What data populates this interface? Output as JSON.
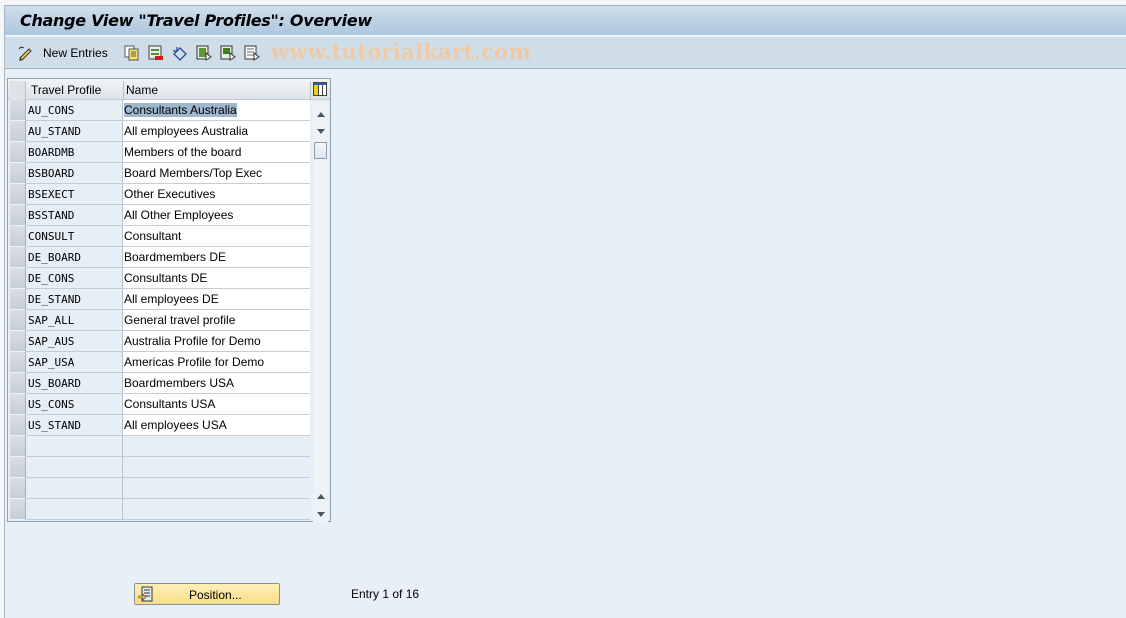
{
  "window": {
    "title": "Change View \"Travel Profiles\": Overview"
  },
  "toolbar": {
    "items": [
      {
        "icon": "edit-pencil-icon",
        "label": "New Entries"
      },
      {
        "icon": "copy-icon",
        "label": ""
      },
      {
        "icon": "delete-icon",
        "label": ""
      },
      {
        "icon": "undo-icon",
        "label": ""
      },
      {
        "icon": "select-all-icon",
        "label": ""
      },
      {
        "icon": "select-block-icon",
        "label": ""
      },
      {
        "icon": "deselect-all-icon",
        "label": ""
      }
    ],
    "watermark": "www.tutorialkart.com"
  },
  "table": {
    "columns": [
      "Travel Profile",
      "Name"
    ],
    "rows": [
      {
        "profile": "AU_CONS",
        "name": "Consultants Australia",
        "selected": true
      },
      {
        "profile": "AU_STAND",
        "name": "All employees Australia"
      },
      {
        "profile": "BOARDMB",
        "name": "Members of the board"
      },
      {
        "profile": "BSBOARD",
        "name": "Board Members/Top Exec"
      },
      {
        "profile": "BSEXECT",
        "name": "Other Executives"
      },
      {
        "profile": "BSSTAND",
        "name": "All Other Employees"
      },
      {
        "profile": "CONSULT",
        "name": "Consultant"
      },
      {
        "profile": "DE_BOARD",
        "name": "Boardmembers DE"
      },
      {
        "profile": "DE_CONS",
        "name": "Consultants DE"
      },
      {
        "profile": "DE_STAND",
        "name": "All employees DE"
      },
      {
        "profile": "SAP_ALL",
        "name": "General travel profile"
      },
      {
        "profile": "SAP_AUS",
        "name": "Australia Profile for Demo"
      },
      {
        "profile": "SAP_USA",
        "name": "Americas Profile for Demo"
      },
      {
        "profile": "US_BOARD",
        "name": "Boardmembers USA"
      },
      {
        "profile": "US_CONS",
        "name": "Consultants USA"
      },
      {
        "profile": "US_STAND",
        "name": "All employees USA"
      }
    ],
    "empty_rows": 4,
    "config_icon": "table-settings-icon"
  },
  "footer": {
    "position_button": "Position...",
    "entry_text": "Entry 1 of 16"
  }
}
